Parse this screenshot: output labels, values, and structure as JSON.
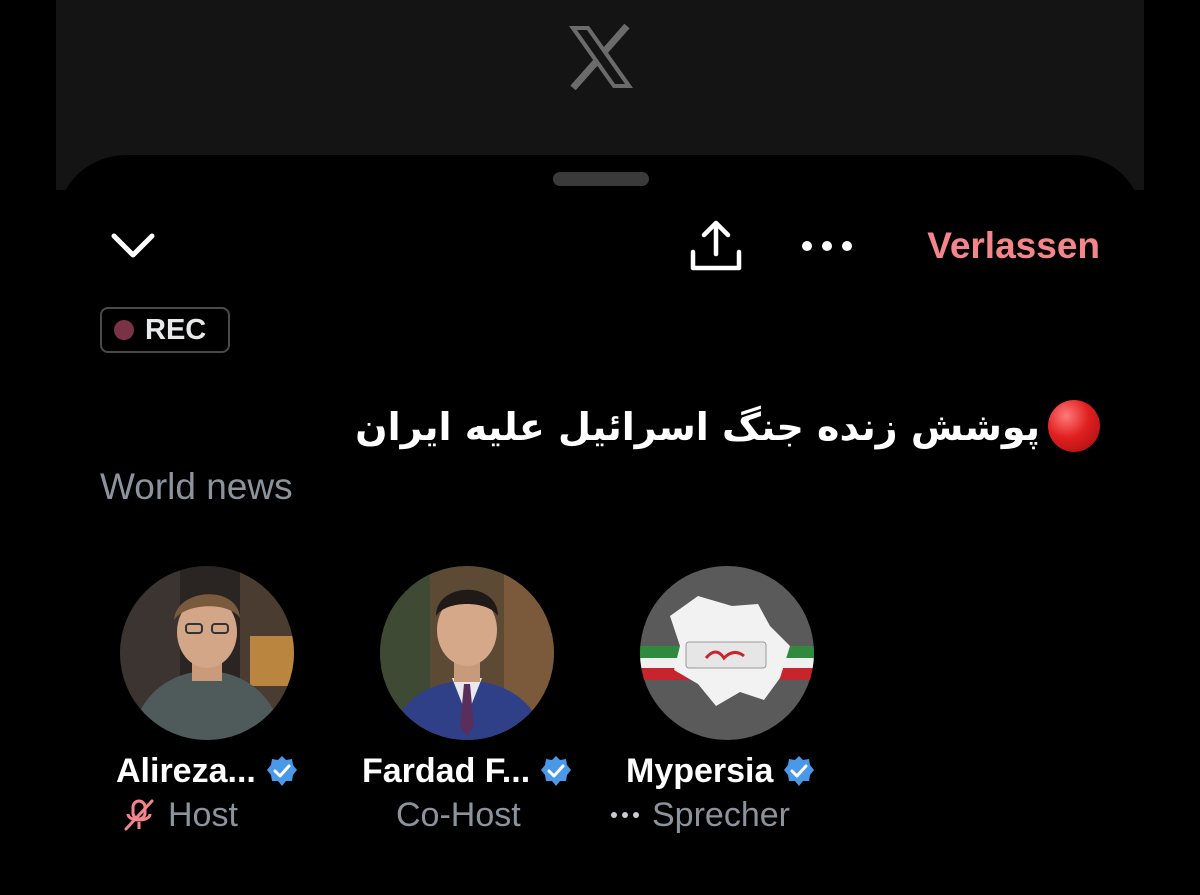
{
  "header": {
    "leave_label": "Verlassen",
    "rec_label": "REC",
    "accent_color": "#f4868b"
  },
  "space": {
    "title": "پوشش زنده جنگ اسرائیل علیه ایران",
    "topic": "World news"
  },
  "speakers": [
    {
      "name": "Alireza...",
      "role": "Host",
      "role_icon": "mic-off-icon",
      "verified": true
    },
    {
      "name": "Fardad F...",
      "role": "Co-Host",
      "verified": true
    },
    {
      "name": "Mypersia",
      "role": "Sprecher",
      "role_icon": "more-dots-icon",
      "verified": true
    }
  ],
  "icons": [
    "x-logo",
    "chevron-down-icon",
    "share-icon",
    "more-icon",
    "verified-icon",
    "live-red-dot-icon"
  ]
}
